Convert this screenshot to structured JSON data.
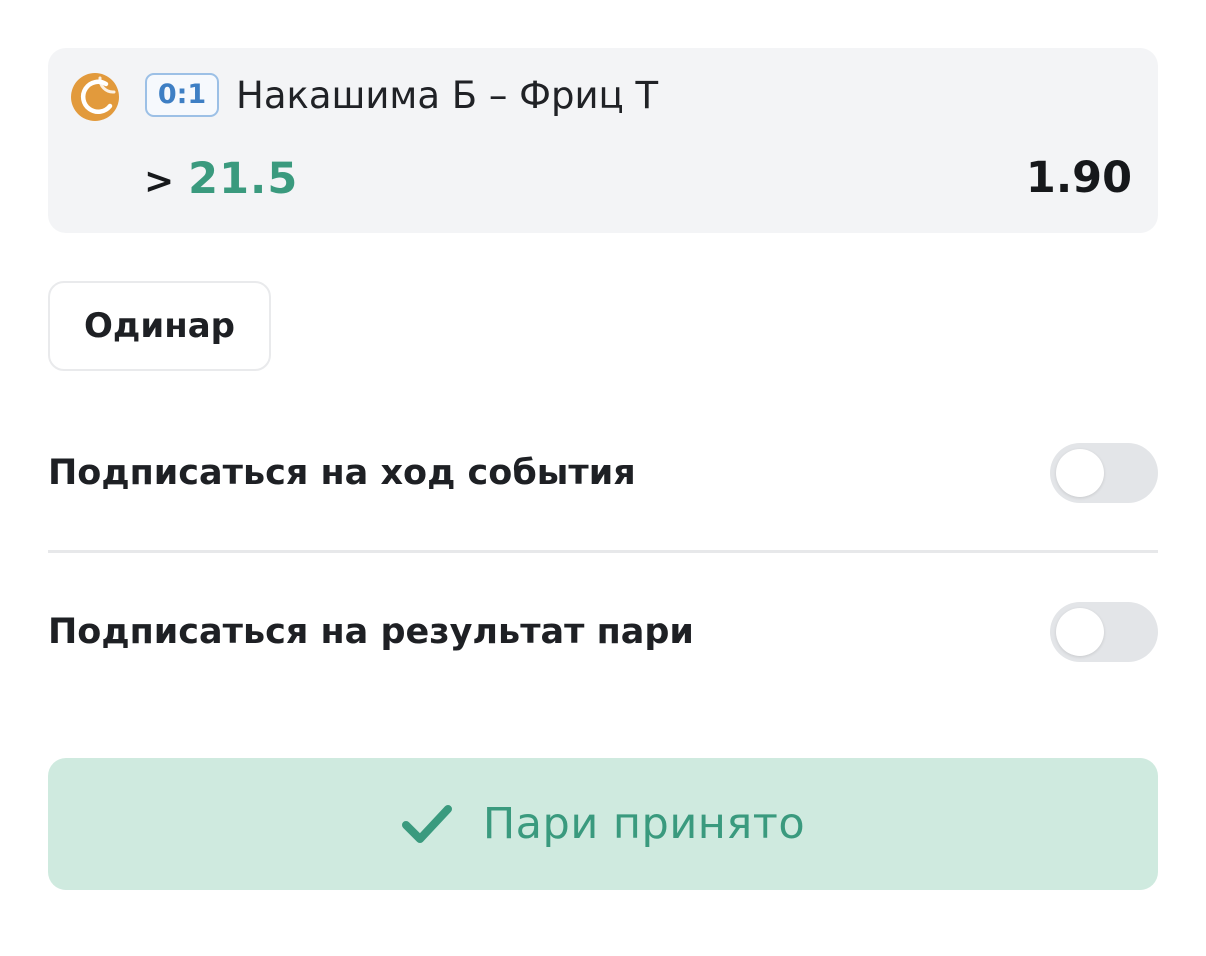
{
  "bet": {
    "sport_icon": "tennis-ball-icon",
    "score": "0:1",
    "event_title": "Накашима Б – Фриц Т",
    "outcome_prefix": ">",
    "outcome_value": "21.5",
    "odds": "1.90"
  },
  "bet_type": {
    "label": "Одинар"
  },
  "subscriptions": [
    {
      "label": "Подписаться на ход события",
      "enabled": false
    },
    {
      "label": "Подписаться на результат пари",
      "enabled": false
    }
  ],
  "status_button": {
    "icon": "check-icon",
    "label": "Пари принято"
  },
  "colors": {
    "card_background": "#f3f4f6",
    "score_badge_border": "#9cc0e6",
    "score_badge_text": "#3e7fc4",
    "outcome_accent": "#3a9a7e",
    "sport_icon": "#e29a3c",
    "toggle_off": "#e3e5e8",
    "accepted_background": "#cfeadf",
    "accepted_text": "#3a9a7e"
  }
}
